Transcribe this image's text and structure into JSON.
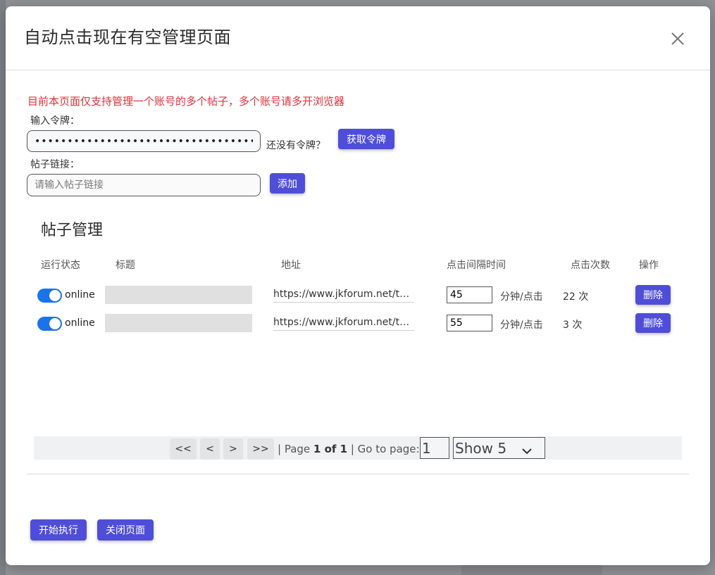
{
  "modal": {
    "title": "自动点击现在有空管理页面",
    "close_icon": "close-icon"
  },
  "notice": "目前本页面仅支持管理一个账号的多个帖子，多个账号请多开浏览器",
  "token": {
    "label": "输入令牌：",
    "value": "••••••••••••••••••••••••••••••••••••",
    "hint": "还没有令牌？",
    "get_button": "获取令牌"
  },
  "post_link": {
    "label": "帖子链接：",
    "placeholder": "请输入帖子链接",
    "add_button": "添加"
  },
  "section_title": "帖子管理",
  "table": {
    "headers": {
      "status": "运行状态",
      "title": "标题",
      "url": "地址",
      "interval": "点击间隔时间",
      "count": "点击次数",
      "ops": "操作"
    },
    "rows": [
      {
        "status": "online",
        "enabled": true,
        "url": "https://www.jkforum.net/thr…",
        "interval": "45",
        "unit": "分钟/点击",
        "count": "22 次",
        "delete": "删除"
      },
      {
        "status": "online",
        "enabled": true,
        "url": "https://www.jkforum.net/thr…",
        "interval": "55",
        "unit": "分钟/点击",
        "count": "3 次",
        "delete": "删除"
      }
    ]
  },
  "pagination": {
    "first": "<<",
    "prev": "<",
    "next": ">",
    "last": ">>",
    "page_prefix": "| Page ",
    "page_current": "1 of 1",
    "goto_label": " | Go to page: ",
    "goto_value": "1",
    "show_value": "Show 5"
  },
  "footer": {
    "start_button": "开始执行",
    "close_button": "关闭页面"
  },
  "colors": {
    "accent": "#4f4ed8",
    "toggle_on": "#1a73e8",
    "notice": "#e0303a"
  }
}
